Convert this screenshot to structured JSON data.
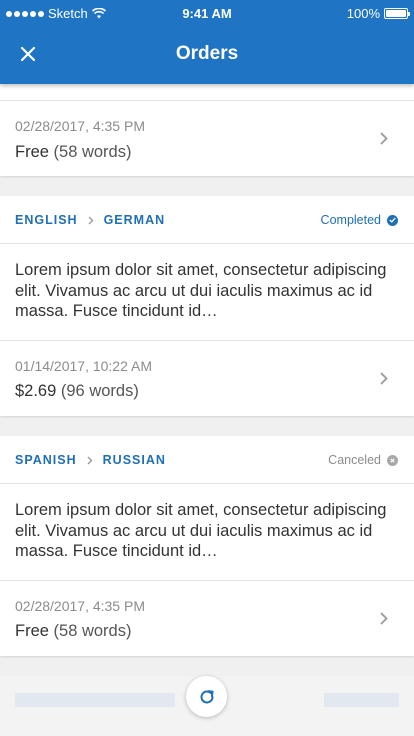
{
  "status_bar": {
    "carrier": "Sketch",
    "time": "9:41 AM",
    "battery": "100%",
    "battery_level": 1.0
  },
  "header": {
    "title": "Orders"
  },
  "orders": [
    {
      "date": "02/28/2017, 4:35 PM",
      "price": "Free",
      "words": "(58 words)"
    },
    {
      "source_lang": "ENGLISH",
      "target_lang": "GERMAN",
      "status": "Completed",
      "text": "Lorem ipsum dolor sit amet, consectetur adipiscing elit. Vivamus ac arcu ut dui iaculis maximus ac id massa. Fusce tincidunt id…",
      "date": "01/14/2017, 10:22 AM",
      "price": "$2.69",
      "words": "(96 words)"
    },
    {
      "source_lang": "SPANISH",
      "target_lang": "RUSSIAN",
      "status": "Canceled",
      "text": "Lorem ipsum dolor sit amet, consectetur adipiscing elit. Vivamus ac arcu ut dui iaculis maximus ac id massa. Fusce tincidunt id…",
      "date": "02/28/2017, 4:35 PM",
      "price": "Free",
      "words": "(58 words)"
    }
  ],
  "colors": {
    "header": "#1f74c4",
    "accent": "#1f6fb5",
    "muted": "#8d8d8d"
  },
  "icons": [
    "close-icon",
    "chevron-right-icon",
    "check-circle-icon",
    "x-circle-icon",
    "refresh-icon",
    "wifi-icon",
    "battery-icon"
  ]
}
